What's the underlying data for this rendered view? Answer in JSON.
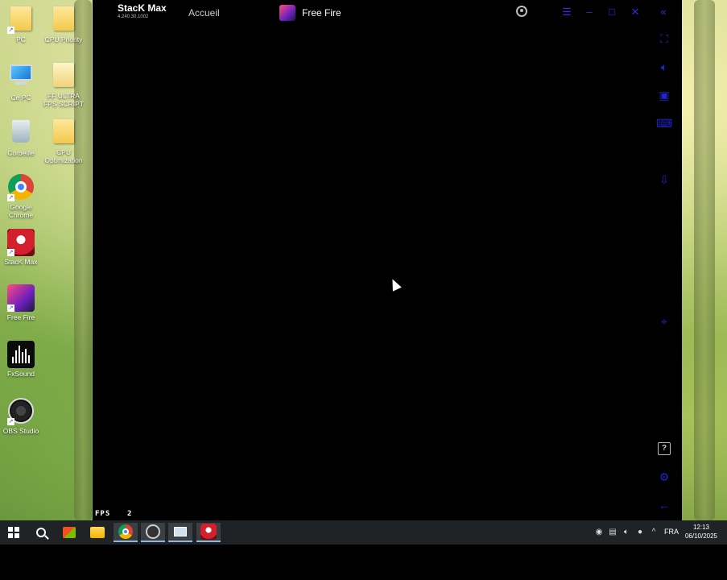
{
  "desktop": {
    "icons": [
      {
        "label": "PC",
        "icon": "folder-user-icon"
      },
      {
        "label": "CPU Priority",
        "icon": "folder-icon"
      },
      {
        "label": "Ce PC",
        "icon": "computer-icon"
      },
      {
        "label": "FF ULTRA FPS SCRIPT",
        "icon": "file-icon"
      },
      {
        "label": "Corbeille",
        "icon": "recycle-bin-icon"
      },
      {
        "label": "CPU Optimization",
        "icon": "folder-icon"
      },
      {
        "label": "Google Chrome",
        "icon": "chrome-icon"
      },
      {
        "label": "StacK Max",
        "icon": "stackmax-icon"
      },
      {
        "label": "Free Fire",
        "icon": "freefire-icon"
      },
      {
        "label": "FxSound",
        "icon": "fxsound-icon"
      },
      {
        "label": "OBS Studio",
        "icon": "obs-icon"
      }
    ]
  },
  "emulator": {
    "brand_name": "StacK Max",
    "version": "4.240.30.1002",
    "tabs": {
      "home": "Accueil",
      "game": "Free Fire"
    },
    "fps_label": "FPS",
    "fps_value": "2",
    "accent_color": "#1f25c9"
  },
  "taskbar": {
    "language": "FRA",
    "time": "12:13",
    "date": "06/10/2025"
  }
}
